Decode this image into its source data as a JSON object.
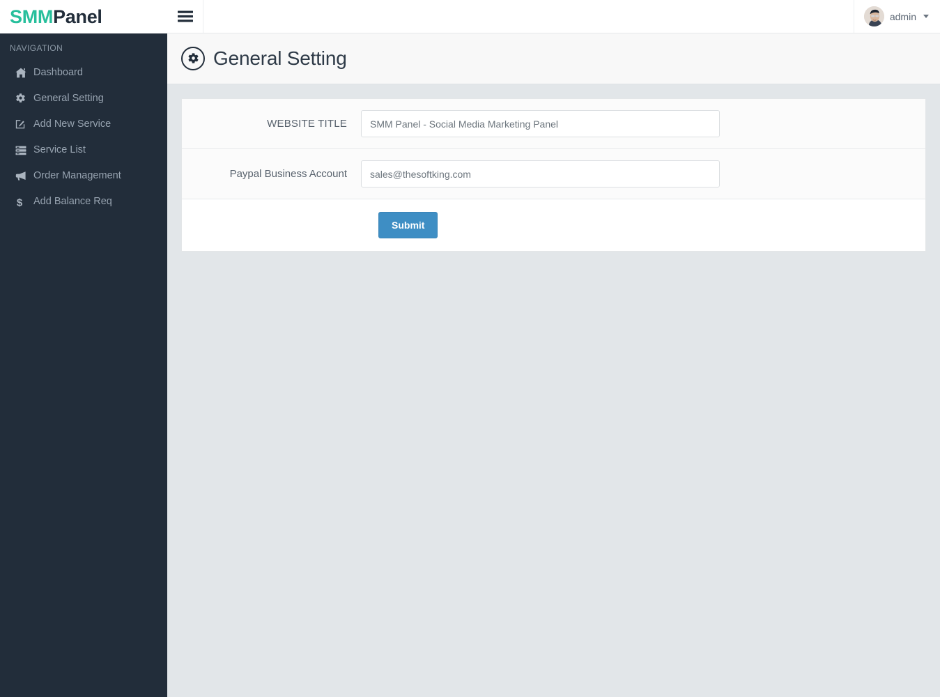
{
  "brand": {
    "logo_primary": "SMM",
    "logo_secondary": "Panel",
    "color_primary": "#27bf9c",
    "color_secondary": "#222d3a"
  },
  "sidebar": {
    "nav_header": "NAVIGATION",
    "background": "#222d3a",
    "items": [
      {
        "label": "Dashboard",
        "icon": "home-icon"
      },
      {
        "label": "General Setting",
        "icon": "gear-icon"
      },
      {
        "label": "Add New Service",
        "icon": "pencil-square-icon"
      },
      {
        "label": "Service List",
        "icon": "server-list-icon"
      },
      {
        "label": "Order Management",
        "icon": "bullhorn-icon"
      },
      {
        "label": "Add Balance Req",
        "icon": "dollar-icon"
      }
    ]
  },
  "navbar": {
    "menu_toggle_icon": "hamburger-icon",
    "user_name": "admin",
    "avatar_icon": "user-avatar",
    "caret_icon": "chevron-down-icon"
  },
  "page": {
    "title": "General Setting",
    "title_icon": "gear-circle-icon"
  },
  "form": {
    "fields": [
      {
        "label": "WEBSITE TITLE",
        "value": "SMM Panel - Social Media Marketing Panel",
        "placeholder": "Website Title",
        "name": "website-title"
      },
      {
        "label": "Paypal Business Account",
        "value": "sales@thesoftking.com",
        "placeholder": "Paypal Business Account",
        "name": "paypal-business-account"
      }
    ],
    "submit_label": "Submit",
    "submit_color": "#3e8ec4"
  }
}
